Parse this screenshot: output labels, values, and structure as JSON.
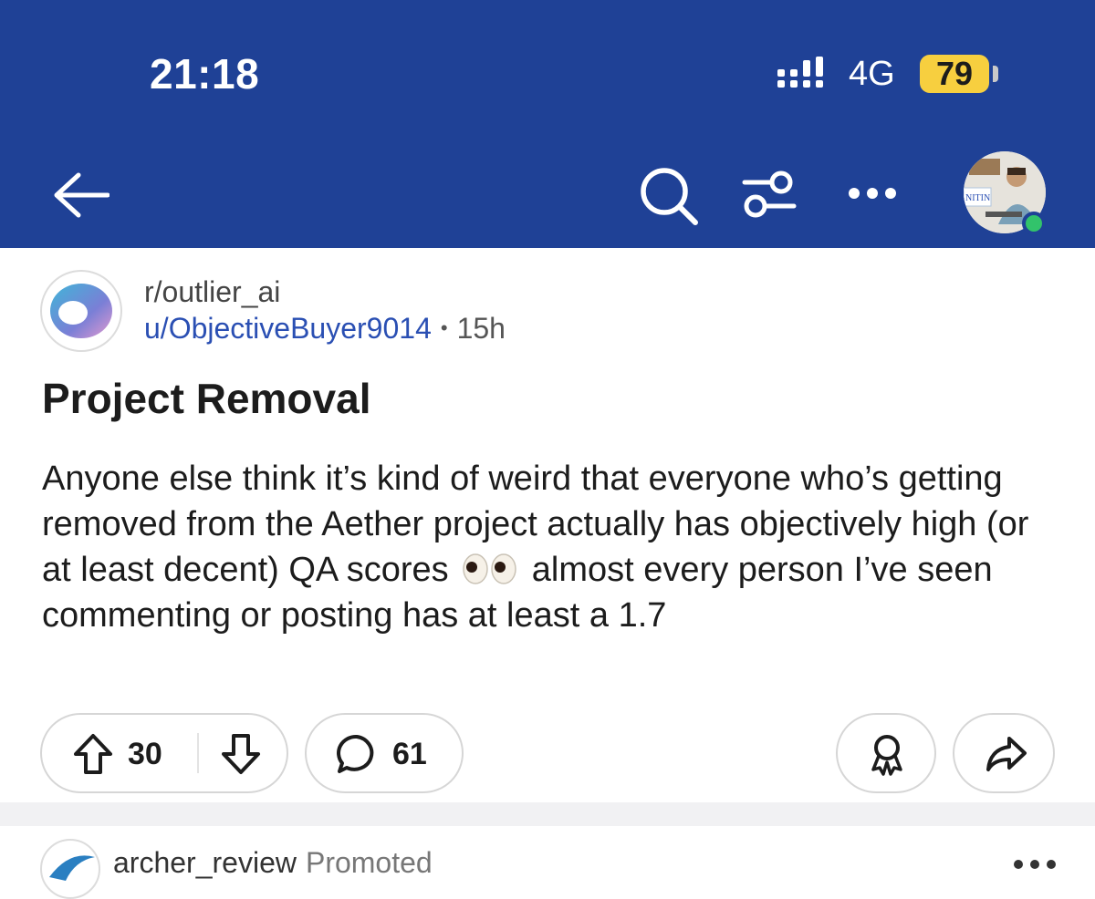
{
  "status_bar": {
    "time": "21:18",
    "network": "4G",
    "battery": "79"
  },
  "nav": {
    "back_icon": "arrow-left-icon",
    "search_icon": "search-icon",
    "filter_icon": "sliders-icon",
    "more_icon": "more-horizontal-icon",
    "avatar_label": "NITIN"
  },
  "post": {
    "subreddit": "r/outlier_ai",
    "author": "u/ObjectiveBuyer9014",
    "separator": "•",
    "age": "15h",
    "title": "Project Removal",
    "body_part1": "Anyone else think it’s kind of weird that everyone who’s getting removed from the Aether project actually has objectively high (or at least decent) QA scores",
    "body_emoji": "eyes-emoji",
    "body_part2": "almost every person I’ve seen commenting or posting has at least a 1.7",
    "votes": "30",
    "comments": "61"
  },
  "next_post": {
    "name": "archer_review",
    "label": "Promoted"
  },
  "colors": {
    "header": "#1f4196",
    "username": "#2a4fb3",
    "battery": "#f7cf3f",
    "online": "#32c36b"
  }
}
